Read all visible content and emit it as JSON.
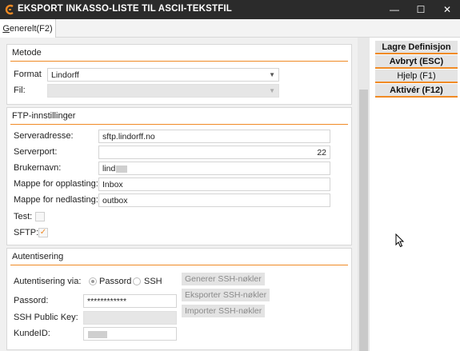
{
  "window": {
    "title": "EKSPORT INKASSO-LISTE TIL ASCII-TEKSTFIL",
    "minimize": "—",
    "maximize": "☐",
    "close": "✕"
  },
  "tabs": [
    {
      "accel": "G",
      "rest": "enerelt(F2)"
    }
  ],
  "actions": {
    "save": "Lagre Definisjon",
    "cancel": "Avbryt (ESC)",
    "help": "Hjelp (F1)",
    "activate": "Aktivér (F12)"
  },
  "metode": {
    "title": "Metode",
    "format_label": "Format",
    "format_value": "Lindorff",
    "file_label": "Fil:"
  },
  "ftp": {
    "title": "FTP-innstillinger",
    "server_label": "Serveradresse:",
    "server_value": "sftp.lindorff.no",
    "port_label": "Serverport:",
    "port_value": "22",
    "user_label": "Brukernavn:",
    "user_value": "lind",
    "upload_label": "Mappe for opplasting:",
    "upload_value": "Inbox",
    "download_label": "Mappe for nedlasting:",
    "download_value": "outbox",
    "test_label": "Test:",
    "sftp_label": "SFTP:",
    "sftp_checked": "✓"
  },
  "auth": {
    "title": "Autentisering",
    "via_label": "Autentisering via:",
    "opt_password": "Passord",
    "opt_ssh": "SSH",
    "password_label": "Passord:",
    "password_value": "************",
    "ssh_key_label": "SSH Public Key:",
    "customer_label": "KundeID:",
    "gen_button": "Generer SSH-nøkler",
    "export_button": "Eksporter SSH-nøkler",
    "import_button": "Importer SSH-nøkler"
  },
  "colors": {
    "accent": "#f08a24",
    "titlebar": "#2b2b2b"
  }
}
